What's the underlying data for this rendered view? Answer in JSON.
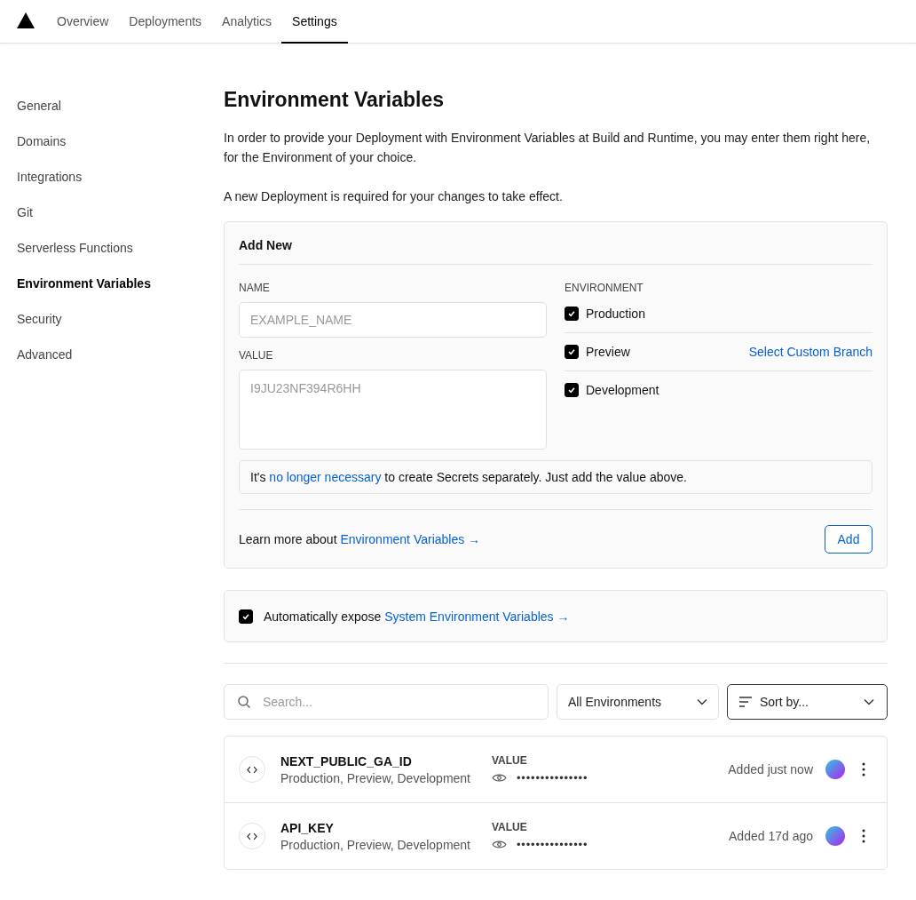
{
  "nav": {
    "tabs": [
      {
        "label": "Overview",
        "selected": false
      },
      {
        "label": "Deployments",
        "selected": false
      },
      {
        "label": "Analytics",
        "selected": false
      },
      {
        "label": "Settings",
        "selected": true
      }
    ]
  },
  "sidebar": {
    "items": [
      {
        "label": "General",
        "selected": false
      },
      {
        "label": "Domains",
        "selected": false
      },
      {
        "label": "Integrations",
        "selected": false
      },
      {
        "label": "Git",
        "selected": false
      },
      {
        "label": "Serverless Functions",
        "selected": false
      },
      {
        "label": "Environment Variables",
        "selected": true
      },
      {
        "label": "Security",
        "selected": false
      },
      {
        "label": "Advanced",
        "selected": false
      }
    ]
  },
  "page": {
    "title": "Environment Variables",
    "intro": "In order to provide your Deployment with Environment Variables at Build and Runtime, you may enter them right here, for the Environment of your choice.",
    "note": "A new Deployment is required for your changes to take effect."
  },
  "add_new": {
    "title": "Add New",
    "name_label": "NAME",
    "name_placeholder": "EXAMPLE_NAME",
    "value_label": "VALUE",
    "value_placeholder": "I9JU23NF394R6HH",
    "environment_label": "ENVIRONMENT",
    "environments": [
      {
        "label": "Production",
        "checked": true
      },
      {
        "label": "Preview",
        "checked": true,
        "link": "Select Custom Branch"
      },
      {
        "label": "Development",
        "checked": true
      }
    ],
    "notice": {
      "before": "It's",
      "link": "no longer necessary",
      "after": "to create Secrets separately. Just add the value above."
    },
    "learn_more": {
      "before": "Learn more about",
      "link": "Environment Variables →"
    },
    "button": "Add"
  },
  "auto_expose": {
    "checked": true,
    "before": "Automatically expose",
    "link": "System Environment Variables →"
  },
  "filters": {
    "search_placeholder": "Search...",
    "environment": "All Environments",
    "sort": "Sort by..."
  },
  "variables": [
    {
      "name": "NEXT_PUBLIC_GA_ID",
      "environments": "Production, Preview, Development",
      "value_label": "VALUE",
      "value": "•••••••••••••••",
      "added": "Added just now"
    },
    {
      "name": "API_KEY",
      "environments": "Production, Preview, Development",
      "value_label": "VALUE",
      "value": "•••••••••••••••",
      "added": "Added 17d ago"
    }
  ]
}
